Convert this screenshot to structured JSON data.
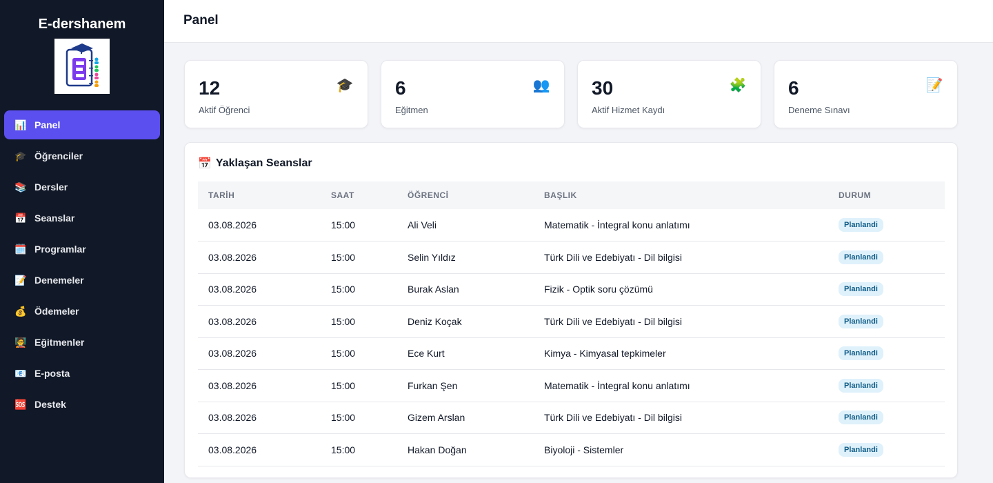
{
  "app": {
    "brand": "E-dershanem"
  },
  "sidebar": {
    "items": [
      {
        "label": "Panel",
        "icon": "bar-chart-icon",
        "glyph": "📊",
        "active": true
      },
      {
        "label": "Öğrenciler",
        "icon": "graduation-cap-icon",
        "glyph": "🎓",
        "active": false
      },
      {
        "label": "Dersler",
        "icon": "books-icon",
        "glyph": "📚",
        "active": false
      },
      {
        "label": "Seanslar",
        "icon": "calendar-icon",
        "glyph": "📅",
        "active": false
      },
      {
        "label": "Programlar",
        "icon": "calendar-page-icon",
        "glyph": "🗓️",
        "active": false
      },
      {
        "label": "Denemeler",
        "icon": "memo-icon",
        "glyph": "📝",
        "active": false
      },
      {
        "label": "Ödemeler",
        "icon": "money-bag-icon",
        "glyph": "💰",
        "active": false
      },
      {
        "label": "Eğitmenler",
        "icon": "teacher-icon",
        "glyph": "🧑‍🏫",
        "active": false
      },
      {
        "label": "E-posta",
        "icon": "email-icon",
        "glyph": "📧",
        "active": false
      },
      {
        "label": "Destek",
        "icon": "sos-icon",
        "glyph": "🆘",
        "active": false
      }
    ]
  },
  "header": {
    "title": "Panel"
  },
  "stats": [
    {
      "value": "12",
      "label": "Aktif Öğrenci",
      "icon": "graduation-cap-icon",
      "glyph": "🎓"
    },
    {
      "value": "6",
      "label": "Eğitmen",
      "icon": "people-icon",
      "glyph": "👥"
    },
    {
      "value": "30",
      "label": "Aktif Hizmet Kaydı",
      "icon": "puzzle-icon",
      "glyph": "🧩"
    },
    {
      "value": "6",
      "label": "Deneme Sınavı",
      "icon": "memo-icon",
      "glyph": "📝"
    }
  ],
  "sessions": {
    "title": "Yaklaşan Seanslar",
    "title_icon": "calendar-icon",
    "columns": [
      "TARİH",
      "SAAT",
      "ÖĞRENCİ",
      "BAŞLIK",
      "DURUM"
    ],
    "rows": [
      {
        "date": "03.08.2026",
        "time": "15:00",
        "student": "Ali Veli",
        "title": "Matematik - İntegral konu anlatımı",
        "status": "Planlandi"
      },
      {
        "date": "03.08.2026",
        "time": "15:00",
        "student": "Selin Yıldız",
        "title": "Türk Dili ve Edebiyatı - Dil bilgisi",
        "status": "Planlandi"
      },
      {
        "date": "03.08.2026",
        "time": "15:00",
        "student": "Burak Aslan",
        "title": "Fizik - Optik soru çözümü",
        "status": "Planlandi"
      },
      {
        "date": "03.08.2026",
        "time": "15:00",
        "student": "Deniz Koçak",
        "title": "Türk Dili ve Edebiyatı - Dil bilgisi",
        "status": "Planlandi"
      },
      {
        "date": "03.08.2026",
        "time": "15:00",
        "student": "Ece Kurt",
        "title": "Kimya - Kimyasal tepkimeler",
        "status": "Planlandi"
      },
      {
        "date": "03.08.2026",
        "time": "15:00",
        "student": "Furkan Şen",
        "title": "Matematik - İntegral konu anlatımı",
        "status": "Planlandi"
      },
      {
        "date": "03.08.2026",
        "time": "15:00",
        "student": "Gizem Arslan",
        "title": "Türk Dili ve Edebiyatı - Dil bilgisi",
        "status": "Planlandi"
      },
      {
        "date": "03.08.2026",
        "time": "15:00",
        "student": "Hakan Doğan",
        "title": "Biyoloji - Sistemler",
        "status": "Planlandi"
      }
    ]
  },
  "colors": {
    "sidebar_bg": "#111827",
    "accent": "#5b4ff0",
    "badge_bg": "#dff1fb",
    "badge_text": "#0c5a86"
  }
}
